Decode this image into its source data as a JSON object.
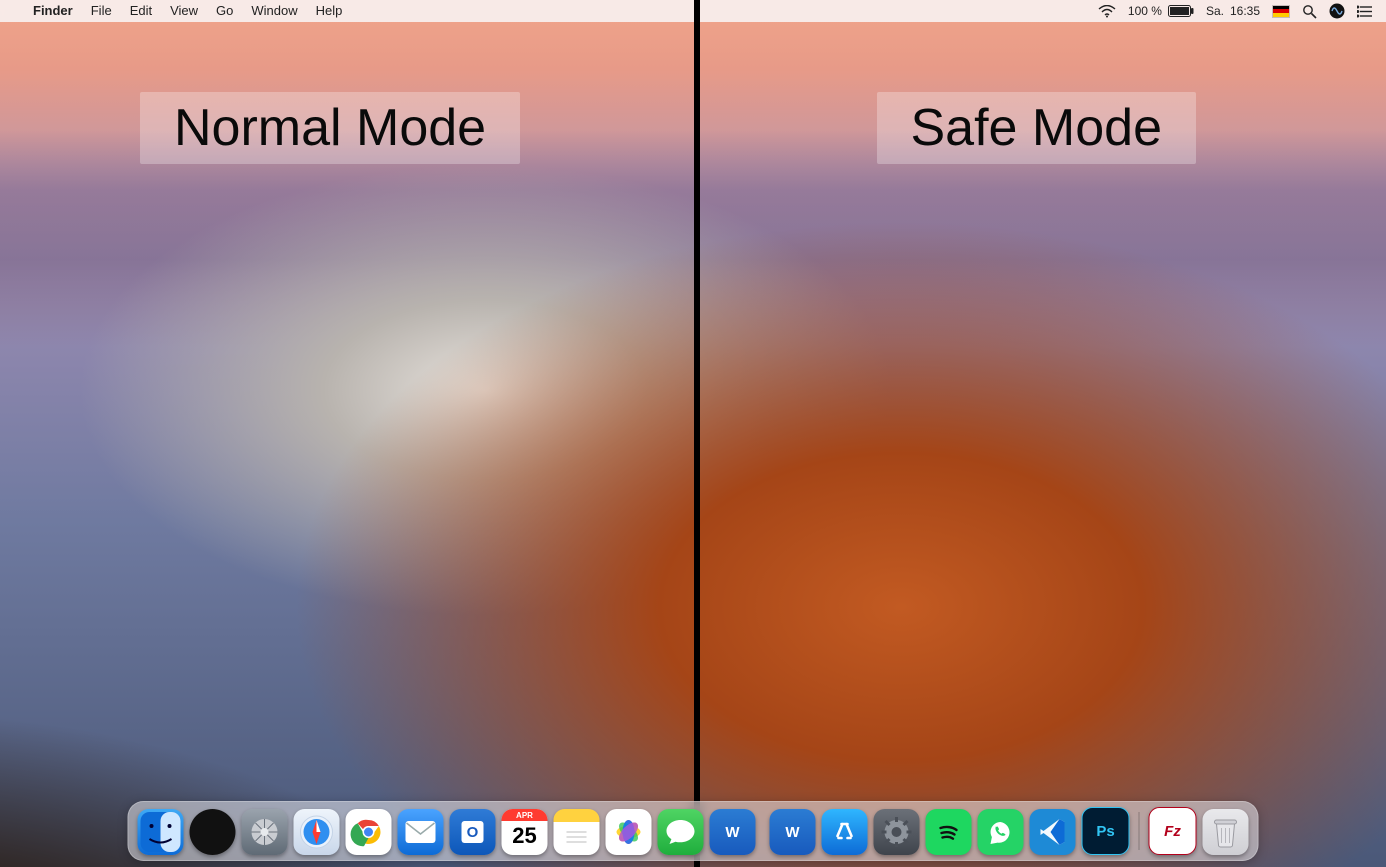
{
  "menubar": {
    "app": "Finder",
    "items": [
      "File",
      "Edit",
      "View",
      "Go",
      "Window",
      "Help"
    ]
  },
  "status": {
    "battery_percent": "100 %",
    "day": "Sa.",
    "time": "16:35"
  },
  "labels": {
    "left": "Normal Mode",
    "right": "Safe Mode"
  },
  "calendar": {
    "month": "APR",
    "day": "25"
  },
  "dock_left": [
    {
      "id": "finder",
      "label": "Finder"
    },
    {
      "id": "siri",
      "label": "Siri"
    },
    {
      "id": "launchpad",
      "label": "Launchpad"
    },
    {
      "id": "safari",
      "label": "Safari"
    },
    {
      "id": "chrome",
      "label": "Google Chrome"
    },
    {
      "id": "mail",
      "label": "Mail"
    },
    {
      "id": "outlook",
      "label": "Outlook"
    },
    {
      "id": "calendar",
      "label": "Calendar"
    },
    {
      "id": "notes",
      "label": "Notes"
    },
    {
      "id": "photos",
      "label": "Photos"
    },
    {
      "id": "messages",
      "label": "Messages"
    },
    {
      "id": "word",
      "label": "Word"
    }
  ],
  "dock_right": [
    {
      "id": "word",
      "label": "Word"
    },
    {
      "id": "appstore",
      "label": "App Store"
    },
    {
      "id": "settings",
      "label": "System Preferences"
    },
    {
      "id": "spotify",
      "label": "Spotify"
    },
    {
      "id": "whatsapp",
      "label": "WhatsApp"
    },
    {
      "id": "vscode",
      "label": "Visual Studio Code"
    },
    {
      "id": "ps",
      "label": "Photoshop"
    },
    {
      "id": "filezilla",
      "label": "FileZilla"
    },
    {
      "id": "trash",
      "label": "Trash"
    }
  ]
}
